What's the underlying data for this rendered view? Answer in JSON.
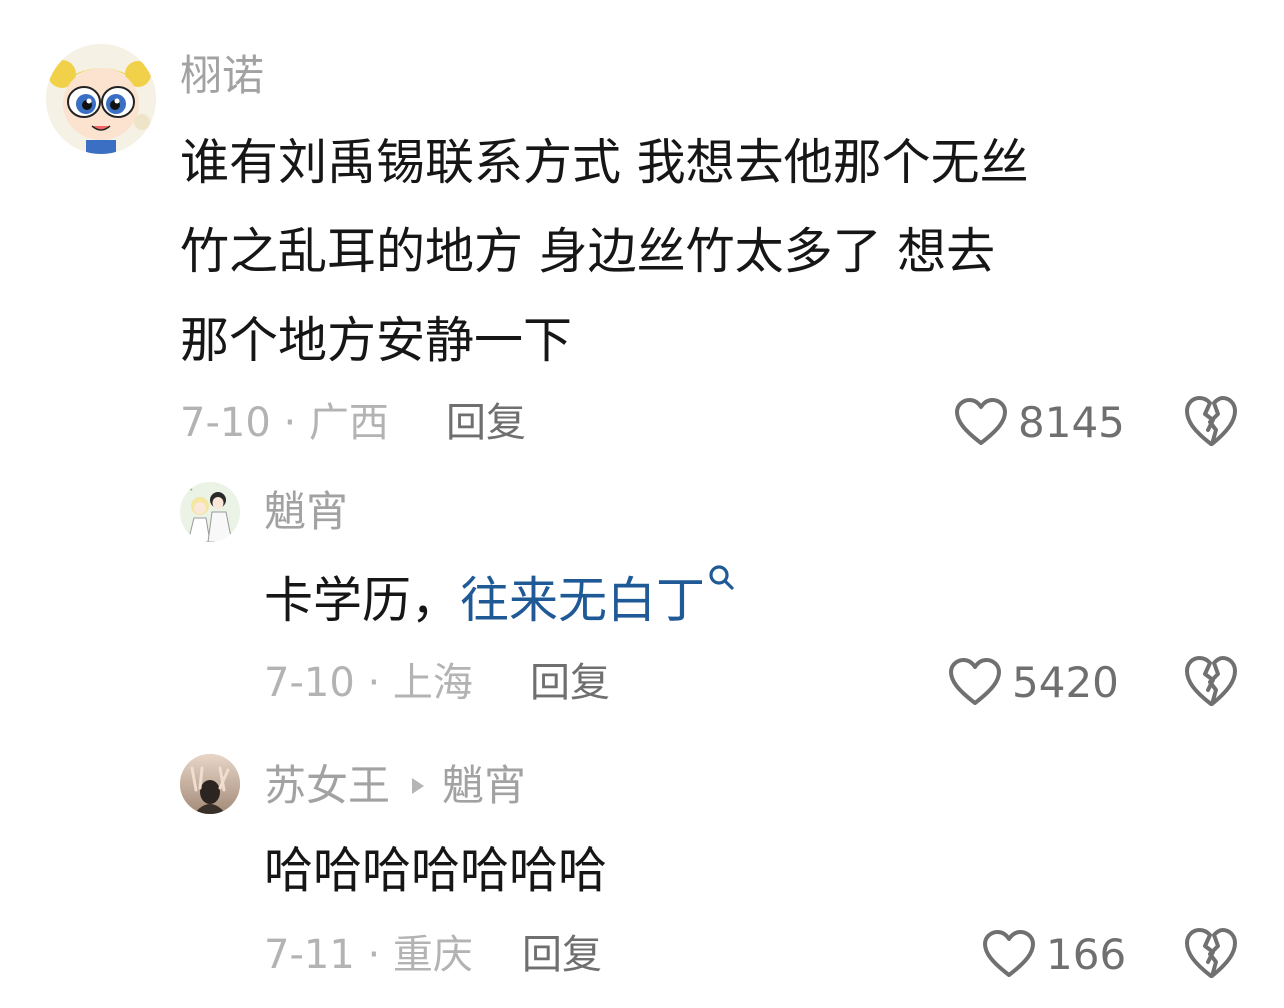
{
  "comments": [
    {
      "username": "栩诺",
      "text": "谁有刘禹锡联系方式 我想去他那个无丝竹之乱耳的地方 身边丝竹太多了 想去那个地方安静一下",
      "lines": [
        "谁有刘禹锡联系方式 我想去他那个无丝",
        "竹之乱耳的地方 身边丝竹太多了 想去",
        "那个地方安静一下"
      ],
      "meta": "7-10 · 广西",
      "reply_label": "回复",
      "likes": "8145",
      "avatar_icon": "powerpuff-bubbles-avatar"
    },
    {
      "username": "魈宵",
      "text_plain": "卡学历，",
      "text_link": "往来无白丁",
      "meta": "7-10 · 上海",
      "reply_label": "回复",
      "likes": "5420",
      "avatar_icon": "anime-couple-avatar"
    },
    {
      "username": "苏女王",
      "reply_to": "魈宵",
      "text": "哈哈哈哈哈哈哈",
      "meta": "7-11 · 重庆",
      "reply_label": "回复",
      "likes": "166",
      "avatar_icon": "person-peace-sign-avatar"
    }
  ],
  "colors": {
    "link": "#1f5a96",
    "username": "#a2a2a2",
    "meta": "#b3b3b3",
    "action": "#6f6f6f"
  }
}
